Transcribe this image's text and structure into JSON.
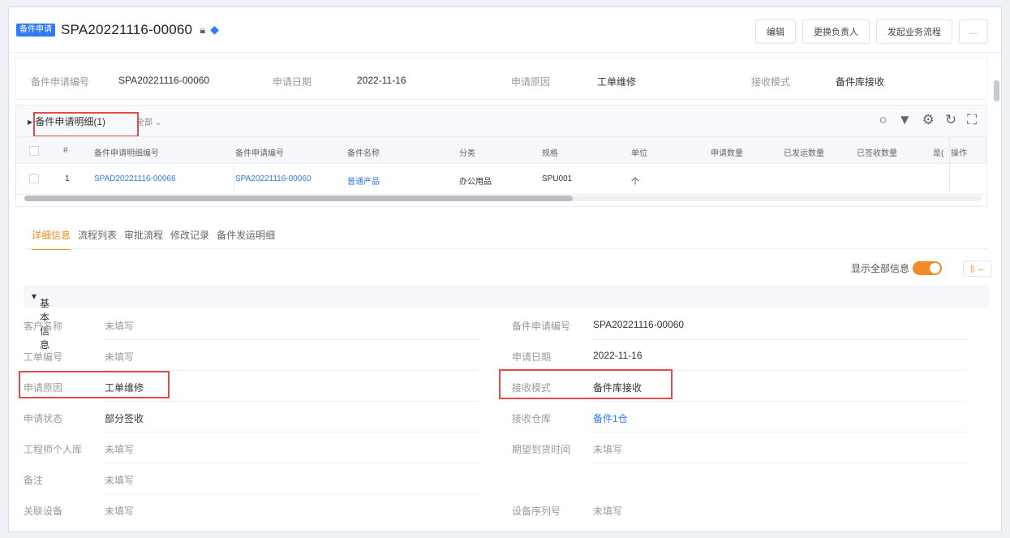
{
  "header": {
    "badge": "备件申请",
    "title": "SPA20221116-00060",
    "buttons": [
      "编辑",
      "更换负责人",
      "发起业务流程"
    ],
    "more": "..."
  },
  "strip": [
    {
      "label": "备件申请编号",
      "value": "SPA20221116-00060"
    },
    {
      "label": "申请日期",
      "value": "2022-11-16"
    },
    {
      "label": "申请原因",
      "value": "工单维修"
    },
    {
      "label": "接收模式",
      "value": "备件库接收"
    }
  ],
  "panel": {
    "title": "备件申请明细(1)",
    "filter": "全部",
    "columns": [
      "#",
      "备件申请明细编号",
      "备件申请编号",
      "备件名称",
      "分类",
      "规格",
      "单位",
      "申请数量",
      "已发运数量",
      "已签收数量",
      "是(",
      "操作"
    ],
    "rows": [
      {
        "index": "1",
        "detail_no": "SPAD20221116-00066",
        "apply_no": "SPA20221116-00060",
        "name": "普通产品",
        "category": "办公用品",
        "spec": "SPU001",
        "unit": "个"
      }
    ]
  },
  "tabs": [
    "详细信息",
    "流程列表",
    "审批流程",
    "修改记录",
    "备件发运明细"
  ],
  "show_all_label": "显示全部信息",
  "cols_btn": "|| ↔",
  "section_title": "基本信息",
  "fields_left": [
    {
      "label": "客户名称",
      "value": "未填写",
      "filled": false
    },
    {
      "label": "工单编号",
      "value": "未填写",
      "filled": false
    },
    {
      "label": "申请原因",
      "value": "工单维修",
      "filled": true
    },
    {
      "label": "申请状态",
      "value": "部分签收",
      "filled": true
    },
    {
      "label": "工程师个人库",
      "value": "未填写",
      "filled": false
    },
    {
      "label": "备注",
      "value": "未填写",
      "filled": false
    },
    {
      "label": "关联设备",
      "value": "未填写",
      "filled": false
    }
  ],
  "fields_right": [
    {
      "label": "备件申请编号",
      "value": "SPA20221116-00060",
      "filled": true
    },
    {
      "label": "申请日期",
      "value": "2022-11-16",
      "filled": true
    },
    {
      "label": "接收模式",
      "value": "备件库接收",
      "filled": true
    },
    {
      "label": "接收仓库",
      "value": "备件1仓",
      "filled": true,
      "link": true
    },
    {
      "label": "期望到货时间",
      "value": "未填写",
      "filled": false
    },
    {
      "label": "设备序列号",
      "value": "未填写",
      "filled": false
    }
  ]
}
